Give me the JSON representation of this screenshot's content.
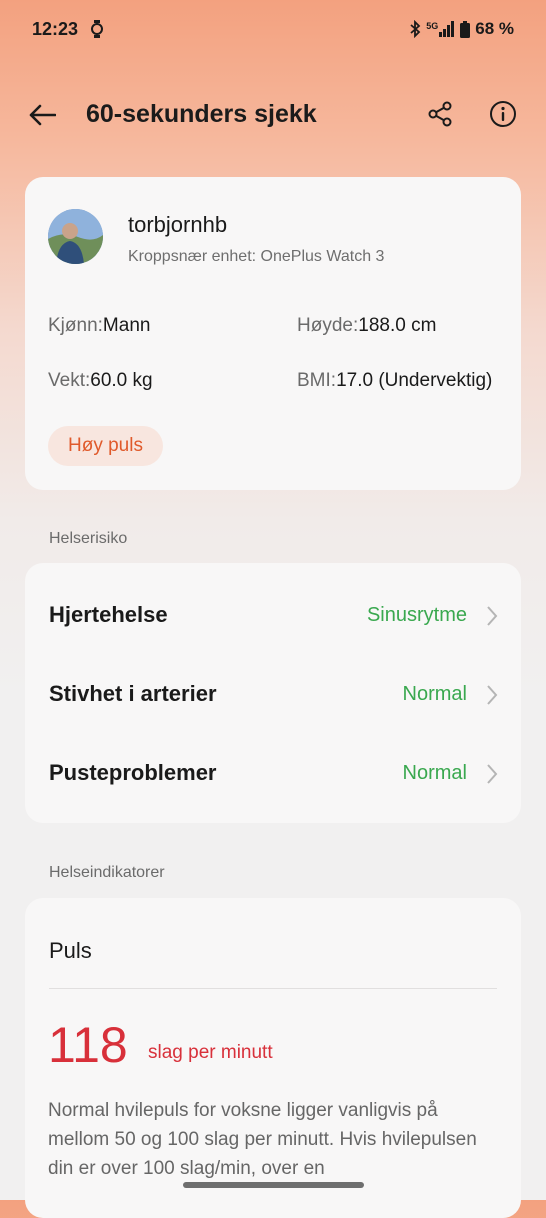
{
  "status_bar": {
    "time": "12:23",
    "battery": "68 %",
    "network": "5G"
  },
  "header": {
    "title": "60-sekunders sjekk"
  },
  "profile": {
    "username": "torbjornhb",
    "device": "Kroppsnær enhet: OnePlus Watch 3",
    "gender_label": "Kjønn:",
    "gender_value": "Mann",
    "height_label": "Høyde:",
    "height_value": "188.0 cm",
    "weight_label": "Vekt:",
    "weight_value": "60.0 kg",
    "bmi_label": "BMI:",
    "bmi_value": "17.0 (Undervektig)",
    "badge": "Høy puls"
  },
  "health_risk": {
    "section_title": "Helserisiko",
    "items": [
      {
        "name": "Hjertehelse",
        "value": "Sinusrytme"
      },
      {
        "name": "Stivhet i arterier",
        "value": "Normal"
      },
      {
        "name": "Pusteproblemer",
        "value": "Normal"
      }
    ]
  },
  "indicators": {
    "section_title": "Helseindikatorer",
    "title": "Puls",
    "value": "118",
    "unit": "slag per minutt",
    "description": "Normal hvilepuls for voksne ligger vanligvis på mellom 50 og 100 slag per minutt. Hvis hvilepulsen din er over 100 slag/min, over en"
  },
  "colors": {
    "accent_orange": "#e05a2b",
    "status_green": "#3aa84f",
    "alert_red": "#d8303a"
  },
  "icons": {
    "back": "arrow-left-icon",
    "share": "share-icon",
    "info": "info-icon",
    "watch": "watch-icon",
    "bluetooth": "bluetooth-icon",
    "signal": "signal-icon",
    "battery": "battery-icon",
    "chevron": "chevron-right-icon"
  }
}
